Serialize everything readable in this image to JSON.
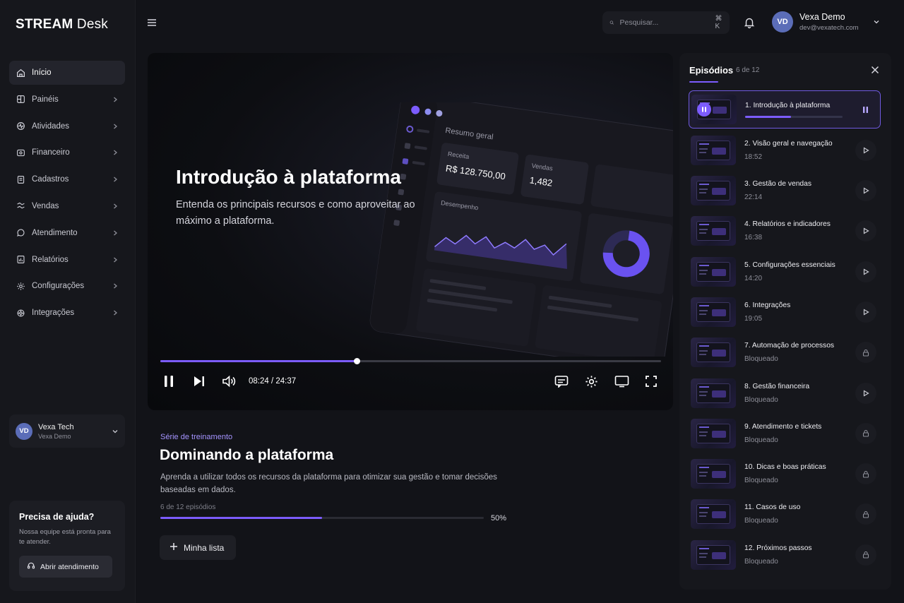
{
  "brand": {
    "bold": "STREAM",
    "light": "Desk"
  },
  "sidebar": {
    "items": [
      {
        "label": "Início",
        "icon": "home-icon",
        "active": true
      },
      {
        "label": "Painéis",
        "icon": "grid-icon"
      },
      {
        "label": "Atividades",
        "icon": "activity-icon"
      },
      {
        "label": "Financeiro",
        "icon": "finance-icon"
      },
      {
        "label": "Cadastros",
        "icon": "form-icon"
      },
      {
        "label": "Vendas",
        "icon": "sales-icon"
      },
      {
        "label": "Atendimento",
        "icon": "chat-icon"
      },
      {
        "label": "Relatórios",
        "icon": "report-icon"
      },
      {
        "label": "Configurações",
        "icon": "gear-icon"
      },
      {
        "label": "Integrações",
        "icon": "integration-icon"
      }
    ],
    "account": {
      "initials": "VD",
      "name": "Vexa Tech",
      "sub": "Vexa Demo"
    },
    "help": {
      "title": "Precisa de ajuda?",
      "text": "Nossa equipe está pronta para te atender.",
      "button": "Abrir atendimento"
    }
  },
  "topbar": {
    "search_placeholder": "Pesquisar...",
    "shortcut": "⌘ K",
    "user": {
      "initials": "VD",
      "name": "Vexa Demo",
      "email": "dev@vexatech.com"
    }
  },
  "player": {
    "title": "Introdução à plataforma",
    "subtitle": "Entenda os principais recursos e como aproveitar ao máximo a plataforma.",
    "current_time": "08:24",
    "total_time": "24:37",
    "progress": 0.393,
    "mock": {
      "heading": "Resumo geral",
      "revenue_label": "Receita",
      "revenue_value": "R$ 128.750,00",
      "sales_label": "Vendas",
      "sales_value": "1,482",
      "chart_label": "Desempenho"
    }
  },
  "series": {
    "label": "Série de treinamento",
    "title": "Dominando a plataforma",
    "description": "Aprenda a utilizar todos os recursos da plataforma para otimizar sua gestão e tomar decisões baseadas em dados.",
    "episode_count": "6 de 12 episódios",
    "percent": "50%",
    "progress": 0.5,
    "mylist_label": "Minha lista"
  },
  "episodes": {
    "title": "Episódios",
    "count": "6 de 12",
    "items": [
      {
        "title": "1. Introdução à plataforma",
        "sub": "",
        "state": "playing",
        "progress": 0.47
      },
      {
        "title": "2. Visão geral e navegação",
        "sub": "18:52",
        "state": "play"
      },
      {
        "title": "3. Gestão de vendas",
        "sub": "22:14",
        "state": "play"
      },
      {
        "title": "4. Relatórios e indicadores",
        "sub": "16:38",
        "state": "play"
      },
      {
        "title": "5. Configurações essenciais",
        "sub": "14:20",
        "state": "play"
      },
      {
        "title": "6. Integrações",
        "sub": "19:05",
        "state": "play"
      },
      {
        "title": "7. Automação de processos",
        "sub": "Bloqueado",
        "state": "locked"
      },
      {
        "title": "8. Gestão financeira",
        "sub": "Bloqueado",
        "state": "play"
      },
      {
        "title": "9. Atendimento e tickets",
        "sub": "Bloqueado",
        "state": "locked"
      },
      {
        "title": "10. Dicas e boas práticas",
        "sub": "Bloqueado",
        "state": "locked"
      },
      {
        "title": "11. Casos de uso",
        "sub": "Bloqueado",
        "state": "locked"
      },
      {
        "title": "12. Próximos passos",
        "sub": "Bloqueado",
        "state": "locked"
      }
    ]
  },
  "colors": {
    "accent": "#7c5cff",
    "background": "#121318",
    "panel": "#16171c"
  }
}
